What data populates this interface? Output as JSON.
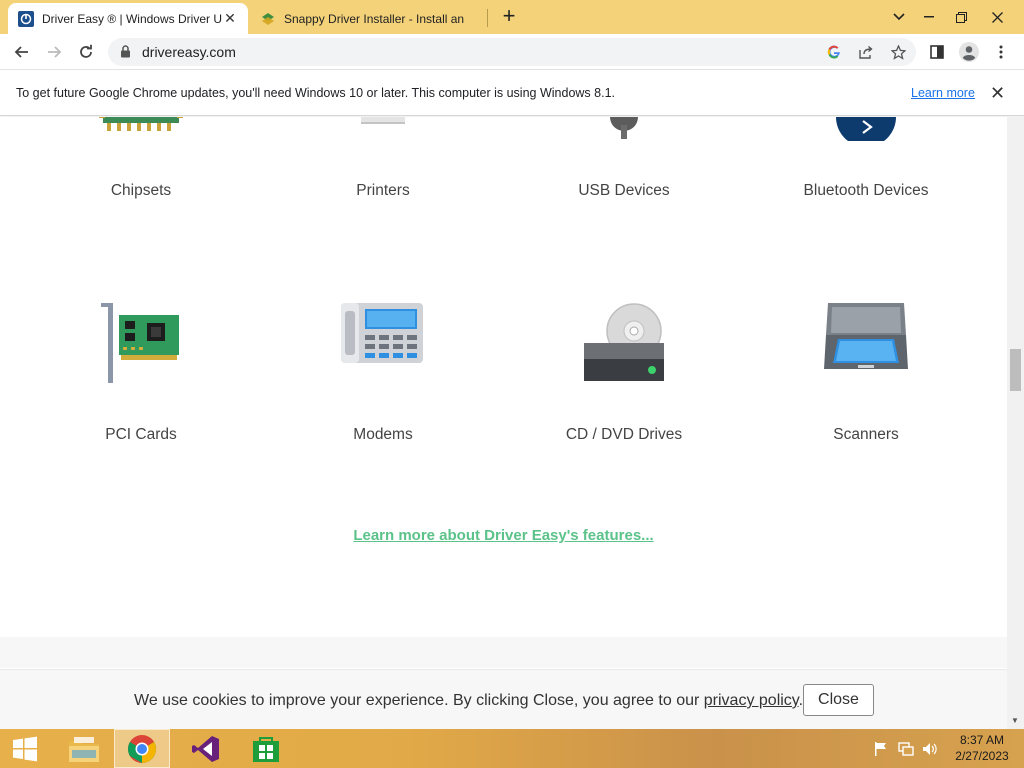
{
  "browser": {
    "tabs": [
      {
        "title": "Driver Easy ® | Windows Driver U",
        "active": true,
        "favicon": "driver-easy-icon"
      },
      {
        "title": "Snappy Driver Installer - Install an",
        "active": false,
        "favicon": "snappy-driver-icon"
      }
    ],
    "new_tab_symbol": "+",
    "url": "drivereasy.com"
  },
  "infobar": {
    "message": "To get future Google Chrome updates, you'll need Windows 10 or later. This computer is using Windows 8.1.",
    "learn_more": "Learn more",
    "close_symbol": "✕"
  },
  "devices": [
    {
      "label": "Chipsets",
      "icon": "chipset-icon"
    },
    {
      "label": "Printers",
      "icon": "printer-icon"
    },
    {
      "label": "USB Devices",
      "icon": "usb-icon"
    },
    {
      "label": "Bluetooth Devices",
      "icon": "bluetooth-icon"
    },
    {
      "label": "PCI Cards",
      "icon": "pci-card-icon"
    },
    {
      "label": "Modems",
      "icon": "modem-icon"
    },
    {
      "label": "CD / DVD Drives",
      "icon": "cd-dvd-drive-icon"
    },
    {
      "label": "Scanners",
      "icon": "scanner-icon"
    }
  ],
  "features_link": "Learn more about Driver Easy's features...",
  "cookie": {
    "text_before": "We use cookies to improve your experience. By clicking Close, you agree to our ",
    "link": "privacy policy",
    "text_after": ".",
    "button": "Close"
  },
  "taskbar": {
    "apps": [
      "start-button",
      "file-explorer-icon",
      "chrome-icon",
      "visual-studio-icon",
      "store-icon"
    ],
    "time": "8:37 AM",
    "date": "2/27/2023"
  },
  "colors": {
    "tabstrip": "#f3d27a",
    "link_green": "#5bc28a",
    "chrome_link_blue": "#1a73e8"
  }
}
